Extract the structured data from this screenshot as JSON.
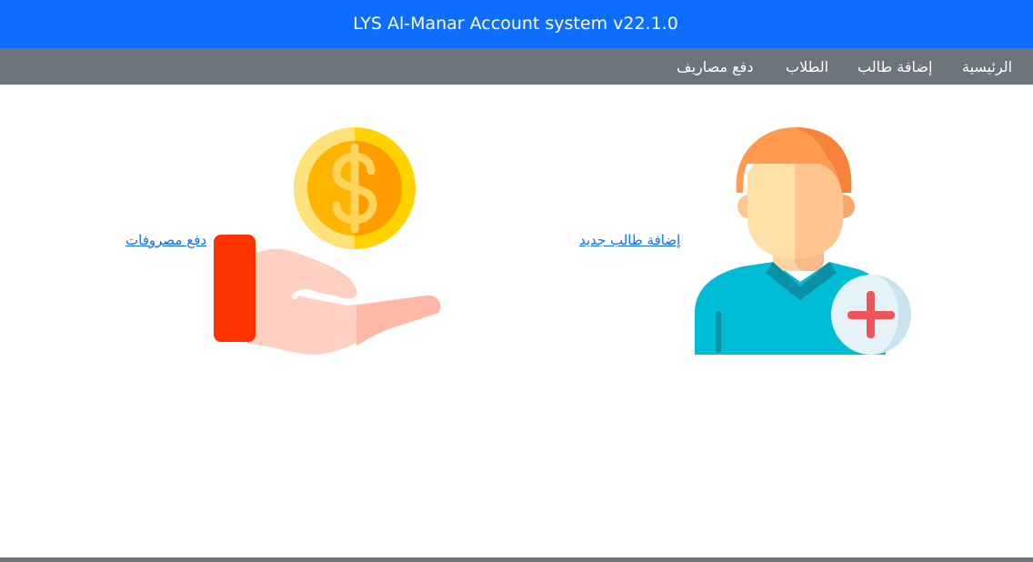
{
  "app": {
    "title": "LYS Al-Manar Account system v22.1.0"
  },
  "nav": {
    "items": [
      {
        "label": "الرئيسية"
      },
      {
        "label": "إضافة طالب"
      },
      {
        "label": "الطلاب"
      },
      {
        "label": "دفع مصاريف"
      }
    ]
  },
  "cards": {
    "add_student": {
      "label": "إضافة طالب جديد",
      "icon": "add-user-icon"
    },
    "pay_expenses": {
      "label": "دفع مصروفات",
      "icon": "hand-coin-icon"
    }
  },
  "colors": {
    "header": "#0d6efd",
    "navbar": "#6c757d",
    "link": "#0d6efd"
  }
}
